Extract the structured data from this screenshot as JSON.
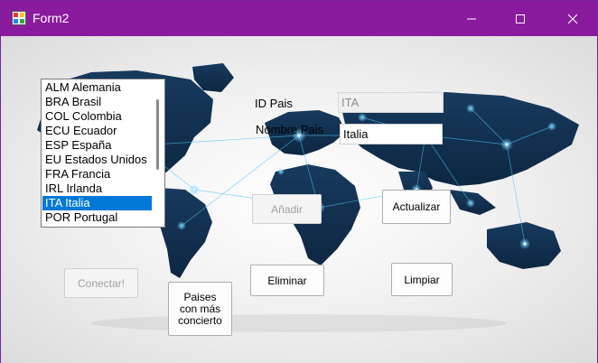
{
  "window": {
    "title": "Form2",
    "controls": {
      "minimize": "minimize",
      "maximize": "maximize",
      "close": "close"
    },
    "accent_color": "#8a1b9e"
  },
  "countries": {
    "items": [
      "ALM Alemania",
      "BRA Brasil",
      "COL Colombia",
      "ECU Ecuador",
      "ESP España",
      "EU Estados Unidos",
      "FRA Francia",
      "IRL Irlanda",
      "ITA Italia",
      "POR Portugal"
    ],
    "selected_index": 8,
    "selection_color": "#0078d7"
  },
  "form": {
    "id_label": "ID Pais",
    "id_value": "ITA",
    "name_label": "Nombre Pais",
    "name_value": "Italia"
  },
  "buttons": {
    "add": "Añadir",
    "update": "Actualizar",
    "delete": "Eliminar",
    "clear": "Limpiar",
    "connect": "Conectar!",
    "concert": "Paises\ncon más\nconcierto"
  },
  "icons": {
    "app": "form-app-icon",
    "minimize": "minimize-icon",
    "maximize": "maximize-icon",
    "close": "close-icon",
    "background": "world-map-network-image"
  }
}
